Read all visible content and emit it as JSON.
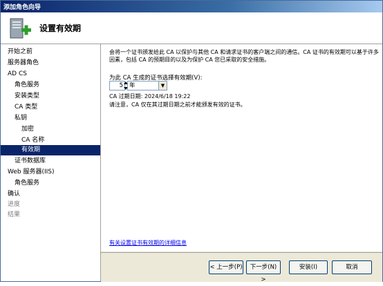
{
  "window": {
    "title": "添加角色向导"
  },
  "header": {
    "title": "设置有效期"
  },
  "sidebar": {
    "items": [
      {
        "label": "开始之前",
        "indent": 0,
        "state": "normal"
      },
      {
        "label": "服务器角色",
        "indent": 0,
        "state": "normal"
      },
      {
        "label": "AD CS",
        "indent": 0,
        "state": "normal"
      },
      {
        "label": "角色服务",
        "indent": 1,
        "state": "normal"
      },
      {
        "label": "安装类型",
        "indent": 1,
        "state": "normal"
      },
      {
        "label": "CA 类型",
        "indent": 1,
        "state": "normal"
      },
      {
        "label": "私钥",
        "indent": 1,
        "state": "normal"
      },
      {
        "label": "加密",
        "indent": 2,
        "state": "normal"
      },
      {
        "label": "CA 名称",
        "indent": 2,
        "state": "normal"
      },
      {
        "label": "有效期",
        "indent": 2,
        "state": "active"
      },
      {
        "label": "证书数据库",
        "indent": 1,
        "state": "normal"
      },
      {
        "label": "Web 服务器(IIS)",
        "indent": 0,
        "state": "normal"
      },
      {
        "label": "角色服务",
        "indent": 1,
        "state": "normal"
      },
      {
        "label": "确认",
        "indent": 0,
        "state": "normal"
      },
      {
        "label": "进度",
        "indent": 0,
        "state": "disabled"
      },
      {
        "label": "结果",
        "indent": 0,
        "state": "disabled"
      }
    ]
  },
  "main": {
    "description": "会将一个证书颁发给此 CA 以保护与其他 CA 和请求证书的客户端之间的通信。CA 证书的有效期可以基于许多因素，包括 CA 的预期目的以及为保护 CA 您已采取的安全措施。",
    "validity_label": "为此 CA 生成的证书选择有效期(V):",
    "validity_value": "5",
    "validity_unit": "年",
    "expiration_text": "CA 过期日期:  2024/6/18 19:22",
    "note_text": "请注意，CA 仅在其过期日期之前才能颁发有效的证书。",
    "link_text": "有关设置证书有效期的详细信息"
  },
  "footer": {
    "prev_label": "< 上一步(P)",
    "next_label": "下一步(N) >",
    "install_label": "安装(I)",
    "cancel_label": "取消"
  }
}
